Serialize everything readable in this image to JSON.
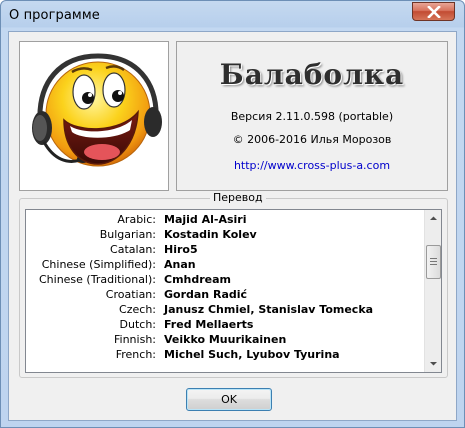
{
  "window": {
    "title": "О программе"
  },
  "about": {
    "app_name": "Балаболка",
    "version": "Версия 2.11.0.598 (portable)",
    "copyright": "© 2006-2016 Илья Морозов",
    "url": "http://www.cross-plus-a.com"
  },
  "translation": {
    "title": "Перевод",
    "rows": [
      {
        "language": "Arabic:",
        "translator": "Majid Al-Asiri"
      },
      {
        "language": "Bulgarian:",
        "translator": "Kostadin Kolev"
      },
      {
        "language": "Catalan:",
        "translator": "Hiro5"
      },
      {
        "language": "Chinese (Simplified):",
        "translator": "Anan"
      },
      {
        "language": "Chinese (Traditional):",
        "translator": "Cmhdream"
      },
      {
        "language": "Croatian:",
        "translator": "Gordan Radić"
      },
      {
        "language": "Czech:",
        "translator": "Janusz Chmiel, Stanislav Tomecka"
      },
      {
        "language": "Dutch:",
        "translator": "Fred Mellaerts"
      },
      {
        "language": "Finnish:",
        "translator": "Veikko Muurikainen"
      },
      {
        "language": "French:",
        "translator": "Michel Such, Lyubov Tyurina"
      }
    ]
  },
  "buttons": {
    "ok": "OK"
  }
}
